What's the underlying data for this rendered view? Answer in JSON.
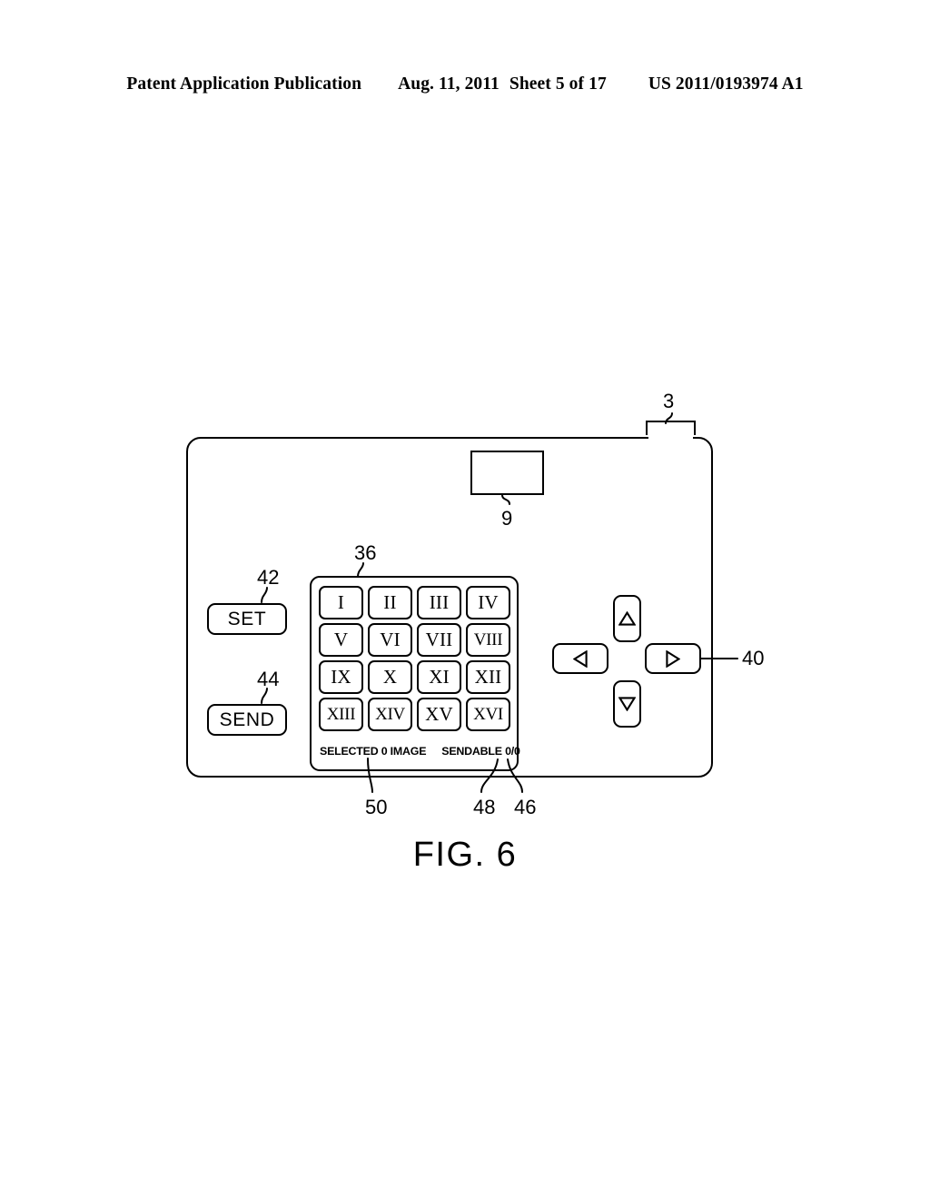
{
  "page_header": {
    "publication": "Patent Application Publication",
    "date": "Aug. 11, 2011",
    "sheet": "Sheet 5 of 17",
    "patent_number": "US 2011/0193974 A1"
  },
  "figure": {
    "caption": "FIG. 6",
    "reference_numerals": {
      "top_tab": "3",
      "viewfinder": "9",
      "grid_panel": "36",
      "dpad": "40",
      "set_button": "42",
      "send_button": "44",
      "sendable_total": "46",
      "sendable_count": "48",
      "selected_status": "50"
    }
  },
  "device": {
    "buttons": {
      "set_label": "SET",
      "send_label": "SEND"
    },
    "keypad": {
      "keys": [
        "I",
        "II",
        "III",
        "IV",
        "V",
        "VI",
        "VII",
        "VIII",
        "IX",
        "X",
        "XI",
        "XII",
        "XIII",
        "XIV",
        "XV",
        "XVI"
      ]
    },
    "status": {
      "selected_text": "SELECTED 0 IMAGE",
      "sendable_text": "SENDABLE 0/0"
    },
    "dpad": {
      "up_icon": "triangle-up-icon",
      "down_icon": "triangle-down-icon",
      "left_icon": "triangle-left-icon",
      "right_icon": "triangle-right-icon"
    }
  },
  "colors": {
    "ink": "#000000",
    "paper": "#ffffff"
  }
}
